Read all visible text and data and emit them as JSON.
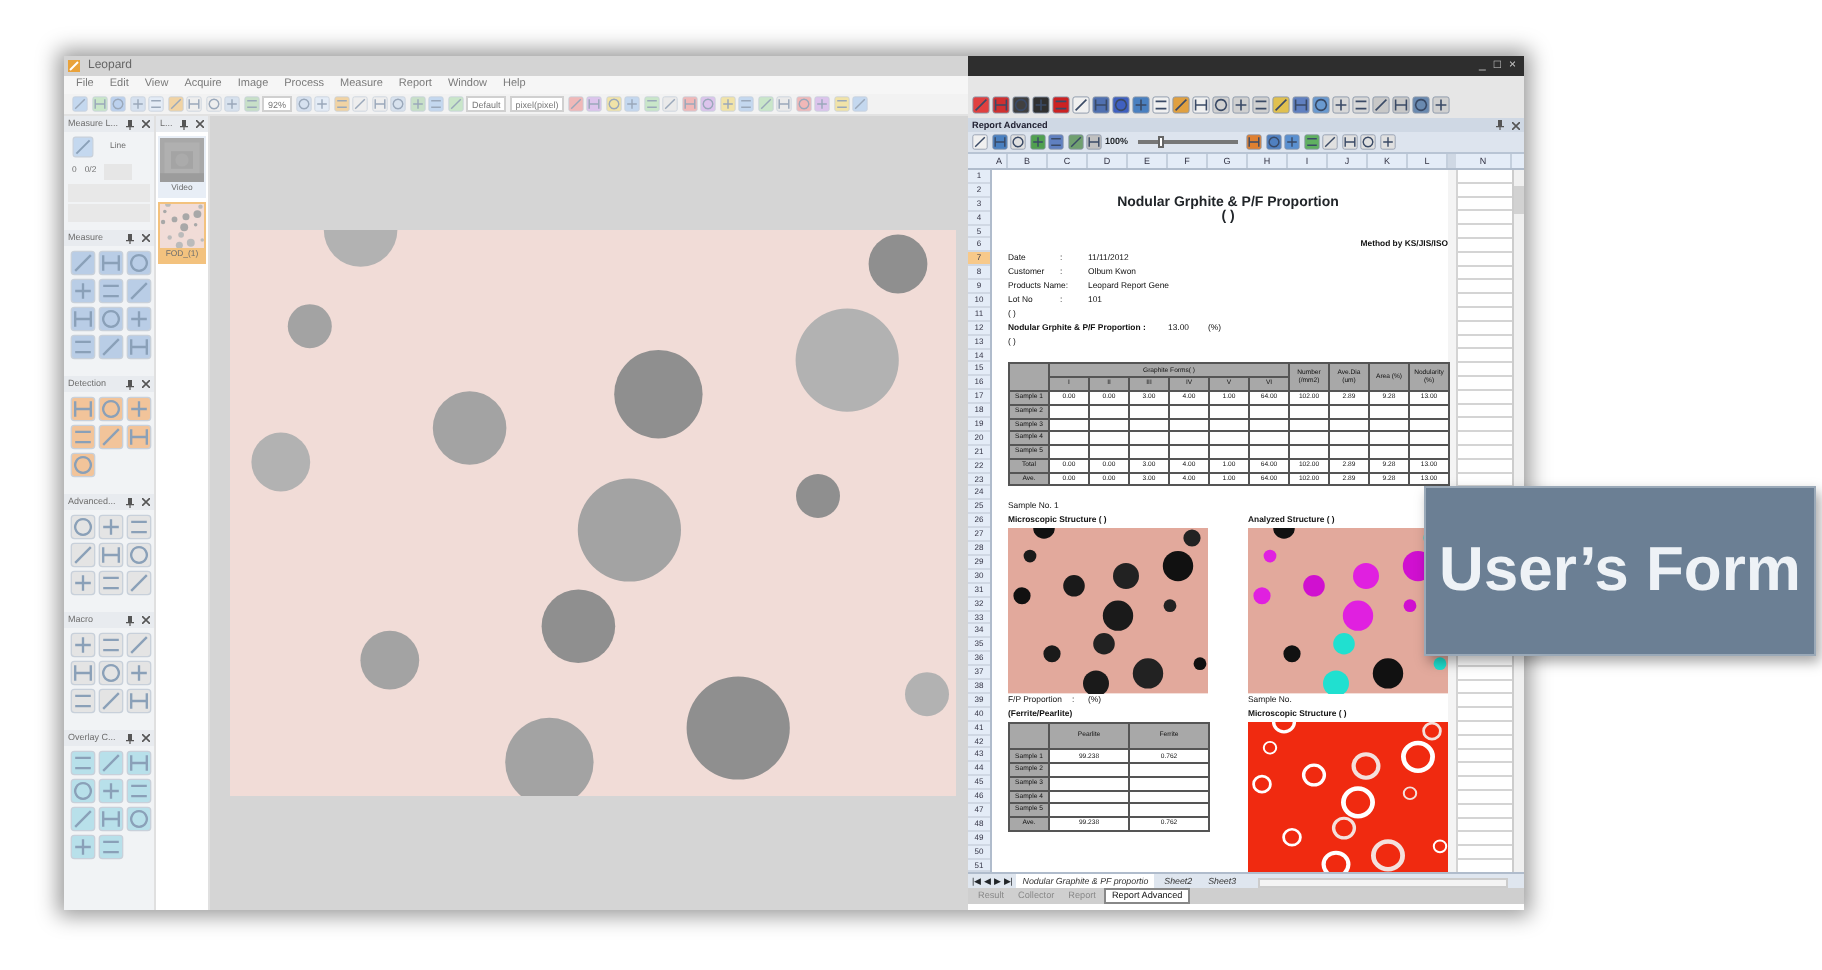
{
  "app": {
    "title": "Leopard",
    "menu": [
      "File",
      "Edit",
      "View",
      "Acquire",
      "Image",
      "Process",
      "Measure",
      "Report",
      "Window",
      "Help"
    ],
    "toolbar": {
      "zoom": "92%",
      "profile": "Default",
      "unit": "pixel(pixel)"
    }
  },
  "measure_panel": {
    "title": "Measure L...",
    "tool": "Line",
    "count": "0",
    "fraction": "0/2"
  },
  "image_panel": {
    "title": "L...",
    "items": [
      {
        "label": "Video",
        "selected": false
      },
      {
        "label": "FOD_(1)",
        "selected": true
      }
    ]
  },
  "tool_panels": [
    {
      "title": "Measure",
      "color": "#b9cde6"
    },
    {
      "title": "Detection",
      "color": "#f2c49a"
    },
    {
      "title": "Advanced...",
      "color": "#e4e4e4"
    },
    {
      "title": "Macro",
      "color": "#e4e4e4"
    },
    {
      "title": "Overlay C...",
      "color": "#b8e0ea"
    }
  ],
  "window_controls": [
    "_",
    "□",
    "×"
  ],
  "report": {
    "title": "Report Advanced",
    "zoom": "100%",
    "zoom_slider": {
      "level": 0.24
    },
    "columns": [
      "A",
      "B",
      "C",
      "D",
      "E",
      "F",
      "G",
      "H",
      "I",
      "J",
      "K",
      "L",
      "N"
    ],
    "rows": [
      {
        "label": "1",
        "selected": false
      },
      {
        "label": "2",
        "selected": false
      },
      {
        "label": "3",
        "selected": false
      },
      {
        "label": "4",
        "selected": false
      },
      {
        "label": "5",
        "selected": false
      },
      {
        "label": "6",
        "selected": false
      },
      {
        "label": "7",
        "selected": true
      },
      {
        "label": "8",
        "selected": false
      },
      {
        "label": "9",
        "selected": false
      },
      {
        "label": "10",
        "selected": false
      },
      {
        "label": "11",
        "selected": false
      },
      {
        "label": "12",
        "selected": false
      },
      {
        "label": "13",
        "selected": false
      },
      {
        "label": "14",
        "selected": false
      },
      {
        "label": "15",
        "selected": false
      },
      {
        "label": "16",
        "selected": false
      },
      {
        "label": "17",
        "selected": false
      },
      {
        "label": "18",
        "selected": false
      },
      {
        "label": "19",
        "selected": false
      },
      {
        "label": "20",
        "selected": false
      },
      {
        "label": "21",
        "selected": false
      },
      {
        "label": "22",
        "selected": false
      },
      {
        "label": "23",
        "selected": false
      },
      {
        "label": "24",
        "selected": false
      },
      {
        "label": "25",
        "selected": false
      },
      {
        "label": "26",
        "selected": false
      },
      {
        "label": "27",
        "selected": false
      },
      {
        "label": "28",
        "selected": false
      },
      {
        "label": "29",
        "selected": false
      },
      {
        "label": "30",
        "selected": false
      },
      {
        "label": "31",
        "selected": false
      },
      {
        "label": "32",
        "selected": false
      },
      {
        "label": "33",
        "selected": false
      },
      {
        "label": "34",
        "selected": false
      },
      {
        "label": "35",
        "selected": false
      },
      {
        "label": "36",
        "selected": false
      },
      {
        "label": "37",
        "selected": false
      },
      {
        "label": "38",
        "selected": false
      },
      {
        "label": "39",
        "selected": false
      },
      {
        "label": "40",
        "selected": false
      },
      {
        "label": "41",
        "selected": false
      },
      {
        "label": "42",
        "selected": false
      },
      {
        "label": "43",
        "selected": false
      },
      {
        "label": "44",
        "selected": false
      },
      {
        "label": "45",
        "selected": false
      },
      {
        "label": "46",
        "selected": false
      },
      {
        "label": "47",
        "selected": false
      },
      {
        "label": "48",
        "selected": false
      },
      {
        "label": "49",
        "selected": false
      },
      {
        "label": "50",
        "selected": false
      },
      {
        "label": "51",
        "selected": false
      }
    ],
    "sheet": {
      "title": "Nodular Grphite & P/F Proportion",
      "subtitle": "( )",
      "method": "Method by KS/JIS/ISO",
      "fields": [
        {
          "label": "Date",
          "sep": ":",
          "value": "11/11/2012"
        },
        {
          "label": "Customer",
          "sep": ":",
          "value": "Olbum Kwon"
        },
        {
          "label": "Products Name",
          "sep": ":",
          "value": "Leopard Report Gene"
        },
        {
          "label": "Lot No",
          "sep": ":",
          "value": "101"
        }
      ],
      "note_before": "( )",
      "result": {
        "label": "Nodular Grphite & P/F Proportion :",
        "value": "13.00",
        "unit": "(%)"
      },
      "note_after": "( )",
      "graphite_table": {
        "group_header": "Graphite Forms( )",
        "form_columns": [
          "I",
          "II",
          "III",
          "IV",
          "V",
          "VI"
        ],
        "extra_columns": [
          "Number (/mm2)",
          "Ave.Dia (um)",
          "Area (%)",
          "Nodularity (%)"
        ],
        "rows": [
          {
            "label": "Sample 1",
            "cells": [
              "0.00",
              "0.00",
              "3.00",
              "4.00",
              "1.00",
              "64.00",
              "102.00",
              "2.89",
              "9.28",
              "13.00"
            ]
          },
          {
            "label": "Sample 2"
          },
          {
            "label": "Sample 3"
          },
          {
            "label": "Sample 4"
          },
          {
            "label": "Sample 5"
          },
          {
            "label": "Total",
            "cells": [
              "0.00",
              "0.00",
              "3.00",
              "4.00",
              "1.00",
              "64.00",
              "102.00",
              "2.89",
              "9.28",
              "13.00"
            ]
          },
          {
            "label": "Ave.",
            "cells": [
              "0.00",
              "0.00",
              "3.00",
              "4.00",
              "1.00",
              "64.00",
              "102.00",
              "2.89",
              "9.28",
              "13.00"
            ]
          }
        ]
      },
      "sample_label": "Sample No. 1",
      "microscopic_label": "Microscopic Structure ( )",
      "analyzed_label": "Analyzed Structure ( )",
      "fp_label": "F/P Proportion",
      "fp_sep": ":",
      "fp_unit": "(%)",
      "fp_caption": "(Ferrite/Pearlite)",
      "fp_table": {
        "columns": [
          "Pearlite",
          "Ferrite"
        ],
        "rows": [
          {
            "label": "Sample 1",
            "cells": [
              "99.238",
              "0.762"
            ]
          },
          {
            "label": "Sample 2"
          },
          {
            "label": "Sample 3"
          },
          {
            "label": "Sample 4"
          },
          {
            "label": "Sample 5"
          },
          {
            "label": "Ave.",
            "cells": [
              "99.238",
              "0.762"
            ]
          }
        ]
      },
      "second_sample_label": "Sample No.",
      "second_microscopic_label": "Microscopic Structure ( )"
    },
    "sheet_nav": [
      "|◀",
      "◀",
      "▶",
      "▶|"
    ],
    "sheet_tabs": [
      {
        "label": "Nodular Graphite & PF proportio",
        "selected": true
      },
      {
        "label": "Sheet2",
        "selected": false
      },
      {
        "label": "Sheet3",
        "selected": false
      }
    ]
  },
  "bottom_tabs": [
    {
      "label": "Result",
      "selected": false
    },
    {
      "label": "Collector",
      "selected": false
    },
    {
      "label": "Report",
      "selected": false
    },
    {
      "label": "Report Advanced",
      "selected": true
    }
  ],
  "callout": {
    "text": "User’s Form"
  }
}
